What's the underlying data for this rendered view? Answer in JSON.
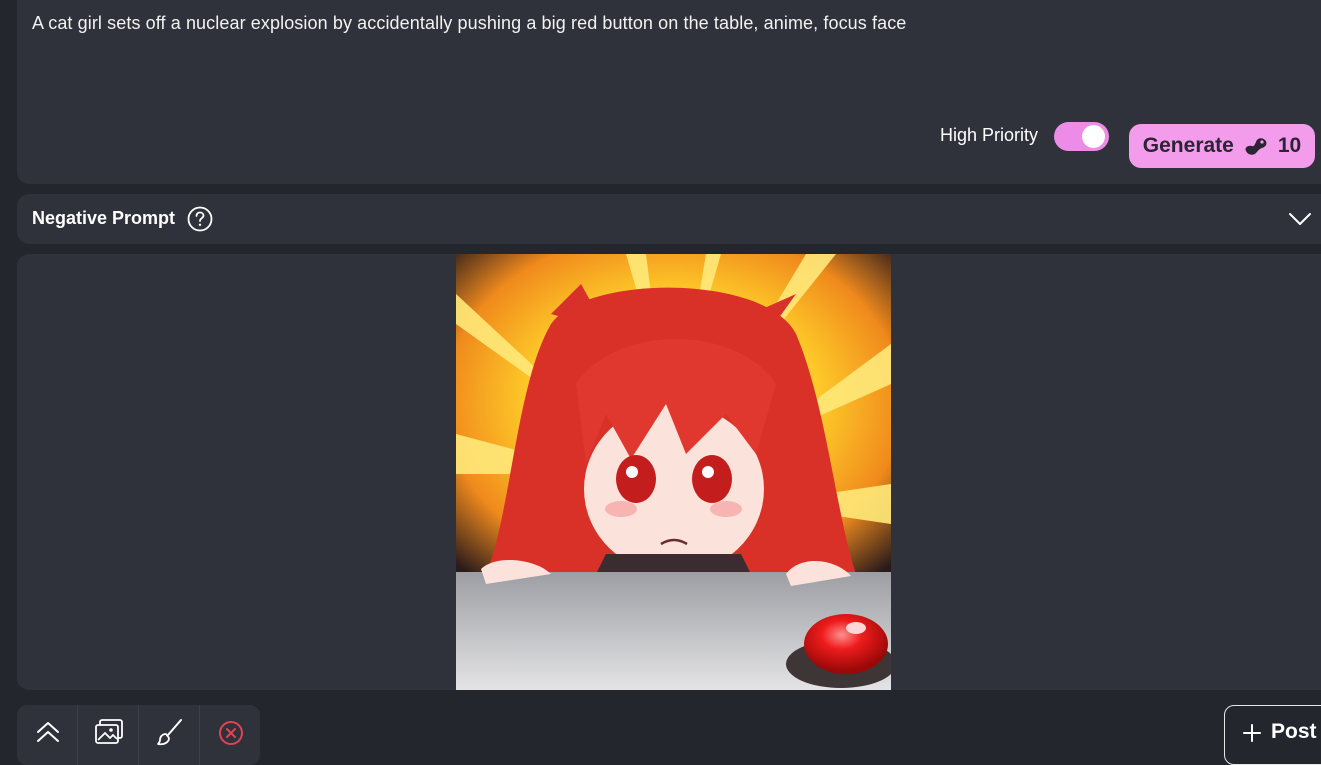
{
  "prompt": {
    "text": "A cat girl sets off a nuclear explosion by accidentally pushing a big red button on the table, anime, focus face"
  },
  "priority": {
    "label": "High Priority",
    "enabled": true
  },
  "generate": {
    "label": "Generate",
    "cost": "10",
    "icon": "bean-icon"
  },
  "negative_prompt": {
    "title": "Negative Prompt",
    "help_icon": "help-circle-icon",
    "expand_icon": "chevron-down-icon"
  },
  "result_image": {
    "description_icon": "generated-image"
  },
  "toolbar": {
    "tools": [
      "collapse-up-icon",
      "gallery-icon",
      "brush-icon",
      "cancel-icon"
    ]
  },
  "post": {
    "label": "Post"
  },
  "colors": {
    "background": "#24262e",
    "panel": "#2f313b",
    "accent_pink": "#f29ceb",
    "toggle_pink": "#ec8ce6",
    "cancel_red": "#e0454f"
  }
}
